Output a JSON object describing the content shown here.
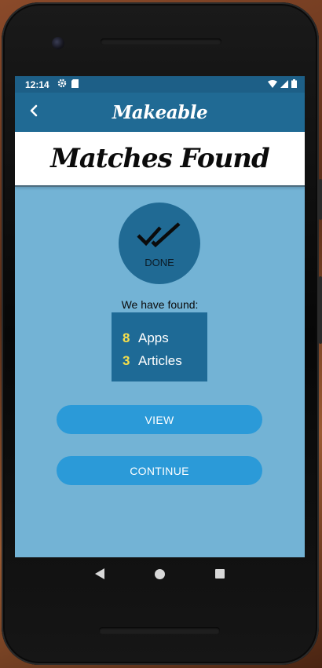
{
  "status_bar": {
    "time": "12:14"
  },
  "app_bar": {
    "title": "Makeable",
    "back_icon": "chevron-left-icon"
  },
  "page": {
    "title": "Matches Found"
  },
  "done_badge": {
    "icon": "double-check-icon",
    "label": "DONE"
  },
  "results": {
    "heading": "We have found:",
    "items": [
      {
        "count": "8",
        "label": "Apps"
      },
      {
        "count": "3",
        "label": "Articles"
      }
    ]
  },
  "buttons": {
    "view_label": "VIEW",
    "continue_label": "CONTINUE"
  },
  "colors": {
    "screen_background": "#73b3d5",
    "app_bar": "#206a94",
    "status_bar": "#1d5f87",
    "button": "#2b9ad8",
    "count_accent": "#f7e04a"
  }
}
